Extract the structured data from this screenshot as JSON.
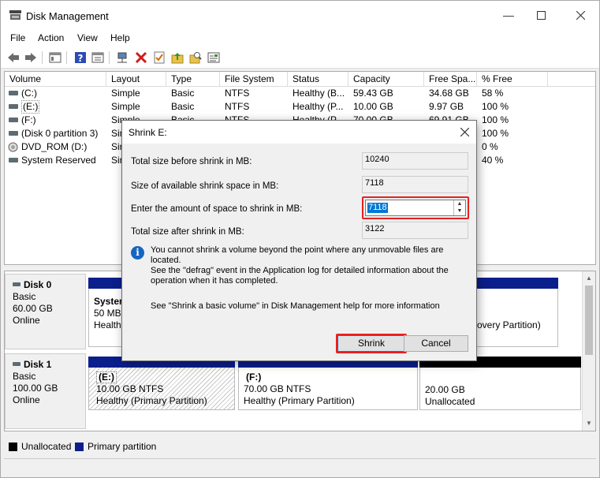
{
  "window": {
    "title": "Disk Management"
  },
  "menu": {
    "items": [
      "File",
      "Action",
      "View",
      "Help"
    ]
  },
  "columns": [
    "Volume",
    "Layout",
    "Type",
    "File System",
    "Status",
    "Capacity",
    "Free Spa...",
    "% Free"
  ],
  "volumes": [
    {
      "name": "(C:)",
      "layout": "Simple",
      "type": "Basic",
      "fs": "NTFS",
      "status": "Healthy (B...",
      "capacity": "59.43 GB",
      "free": "34.68 GB",
      "pct": "58 %"
    },
    {
      "name": "(E:)",
      "layout": "Simple",
      "type": "Basic",
      "fs": "NTFS",
      "status": "Healthy (P...",
      "capacity": "10.00 GB",
      "free": "9.97 GB",
      "pct": "100 %"
    },
    {
      "name": "(F:)",
      "layout": "Simple",
      "type": "Basic",
      "fs": "NTFS",
      "status": "Healthy (P...",
      "capacity": "70.00 GB",
      "free": "69.91 GB",
      "pct": "100 %"
    },
    {
      "name": "(Disk 0 partition 3)",
      "layout": "Sim",
      "type": "",
      "fs": "",
      "status": "",
      "capacity": "",
      "free": "",
      "pct": "100 %"
    },
    {
      "name": "DVD_ROM (D:)",
      "layout": "Sir",
      "type": "",
      "fs": "",
      "status": "",
      "capacity": "",
      "free": "",
      "pct": "0 %"
    },
    {
      "name": "System Reserved",
      "layout": "Sir",
      "type": "",
      "fs": "",
      "status": "",
      "capacity": "",
      "free": "",
      "pct": "40 %"
    }
  ],
  "disks": [
    {
      "name": "Disk 0",
      "type": "Basic",
      "size": "60.00 GB",
      "state": "Online",
      "partitions": [
        {
          "label": "System",
          "size": "50 MB",
          "status": "Healthy"
        },
        {
          "label": "",
          "size": "",
          "status": "overy Partition)"
        }
      ]
    },
    {
      "name": "Disk 1",
      "type": "Basic",
      "size": "100.00 GB",
      "state": "Online",
      "partitions": [
        {
          "label": "(E:)",
          "size": "10.00 GB NTFS",
          "status": "Healthy (Primary Partition)"
        },
        {
          "label": "(F:)",
          "size": "70.00 GB NTFS",
          "status": "Healthy (Primary Partition)"
        },
        {
          "label": "",
          "size": "20.00 GB",
          "status": "Unallocated"
        }
      ]
    }
  ],
  "legend": [
    {
      "label": "Unallocated",
      "color": "#000000"
    },
    {
      "label": "Primary partition",
      "color": "#0a1e8c"
    }
  ],
  "dialog": {
    "title": "Shrink E:",
    "fields": [
      {
        "label": "Total size before shrink in MB:",
        "value": "10240"
      },
      {
        "label": "Size of available shrink space in MB:",
        "value": "7118"
      },
      {
        "label": "Enter the amount of space to shrink in MB:",
        "value": "7118"
      },
      {
        "label": "Total size after shrink in MB:",
        "value": "3122"
      }
    ],
    "message_lines": [
      "You cannot shrink a volume beyond the point where any unmovable files are located.",
      "See the \"defrag\" event in the Application log for detailed information about the",
      "operation when it has completed."
    ],
    "help_text": "See \"Shrink a basic volume\" in Disk Management help for more information",
    "shrink_button": "Shrink",
    "cancel_button": "Cancel"
  },
  "colors": {
    "highlight": "#e42222",
    "primary": "#0a1e8c",
    "selection": "#0078d7"
  },
  "icons": [
    "disk-management-app-icon",
    "back-arrow-icon",
    "forward-arrow-icon",
    "console-tree-icon",
    "help-icon",
    "properties-icon",
    "connect-icon",
    "delete-icon",
    "check-icon",
    "up-folder-icon",
    "search-icon",
    "settings-icon",
    "minimize-icon",
    "maximize-icon",
    "close-icon",
    "info-icon"
  ]
}
